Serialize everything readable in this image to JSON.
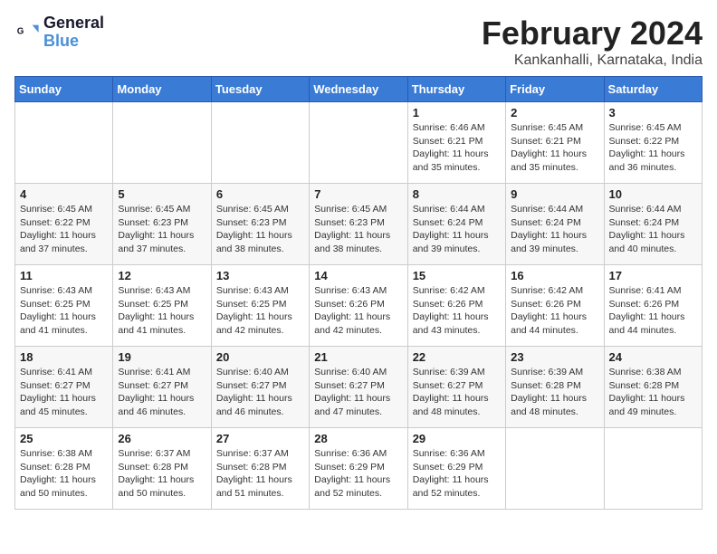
{
  "logo": {
    "line1": "General",
    "line2": "Blue"
  },
  "title": "February 2024",
  "location": "Kankanhalli, Karnataka, India",
  "days_of_week": [
    "Sunday",
    "Monday",
    "Tuesday",
    "Wednesday",
    "Thursday",
    "Friday",
    "Saturday"
  ],
  "weeks": [
    [
      {
        "day": "",
        "info": ""
      },
      {
        "day": "",
        "info": ""
      },
      {
        "day": "",
        "info": ""
      },
      {
        "day": "",
        "info": ""
      },
      {
        "day": "1",
        "info": "Sunrise: 6:46 AM\nSunset: 6:21 PM\nDaylight: 11 hours\nand 35 minutes."
      },
      {
        "day": "2",
        "info": "Sunrise: 6:45 AM\nSunset: 6:21 PM\nDaylight: 11 hours\nand 35 minutes."
      },
      {
        "day": "3",
        "info": "Sunrise: 6:45 AM\nSunset: 6:22 PM\nDaylight: 11 hours\nand 36 minutes."
      }
    ],
    [
      {
        "day": "4",
        "info": "Sunrise: 6:45 AM\nSunset: 6:22 PM\nDaylight: 11 hours\nand 37 minutes."
      },
      {
        "day": "5",
        "info": "Sunrise: 6:45 AM\nSunset: 6:23 PM\nDaylight: 11 hours\nand 37 minutes."
      },
      {
        "day": "6",
        "info": "Sunrise: 6:45 AM\nSunset: 6:23 PM\nDaylight: 11 hours\nand 38 minutes."
      },
      {
        "day": "7",
        "info": "Sunrise: 6:45 AM\nSunset: 6:23 PM\nDaylight: 11 hours\nand 38 minutes."
      },
      {
        "day": "8",
        "info": "Sunrise: 6:44 AM\nSunset: 6:24 PM\nDaylight: 11 hours\nand 39 minutes."
      },
      {
        "day": "9",
        "info": "Sunrise: 6:44 AM\nSunset: 6:24 PM\nDaylight: 11 hours\nand 39 minutes."
      },
      {
        "day": "10",
        "info": "Sunrise: 6:44 AM\nSunset: 6:24 PM\nDaylight: 11 hours\nand 40 minutes."
      }
    ],
    [
      {
        "day": "11",
        "info": "Sunrise: 6:43 AM\nSunset: 6:25 PM\nDaylight: 11 hours\nand 41 minutes."
      },
      {
        "day": "12",
        "info": "Sunrise: 6:43 AM\nSunset: 6:25 PM\nDaylight: 11 hours\nand 41 minutes."
      },
      {
        "day": "13",
        "info": "Sunrise: 6:43 AM\nSunset: 6:25 PM\nDaylight: 11 hours\nand 42 minutes."
      },
      {
        "day": "14",
        "info": "Sunrise: 6:43 AM\nSunset: 6:26 PM\nDaylight: 11 hours\nand 42 minutes."
      },
      {
        "day": "15",
        "info": "Sunrise: 6:42 AM\nSunset: 6:26 PM\nDaylight: 11 hours\nand 43 minutes."
      },
      {
        "day": "16",
        "info": "Sunrise: 6:42 AM\nSunset: 6:26 PM\nDaylight: 11 hours\nand 44 minutes."
      },
      {
        "day": "17",
        "info": "Sunrise: 6:41 AM\nSunset: 6:26 PM\nDaylight: 11 hours\nand 44 minutes."
      }
    ],
    [
      {
        "day": "18",
        "info": "Sunrise: 6:41 AM\nSunset: 6:27 PM\nDaylight: 11 hours\nand 45 minutes."
      },
      {
        "day": "19",
        "info": "Sunrise: 6:41 AM\nSunset: 6:27 PM\nDaylight: 11 hours\nand 46 minutes."
      },
      {
        "day": "20",
        "info": "Sunrise: 6:40 AM\nSunset: 6:27 PM\nDaylight: 11 hours\nand 46 minutes."
      },
      {
        "day": "21",
        "info": "Sunrise: 6:40 AM\nSunset: 6:27 PM\nDaylight: 11 hours\nand 47 minutes."
      },
      {
        "day": "22",
        "info": "Sunrise: 6:39 AM\nSunset: 6:27 PM\nDaylight: 11 hours\nand 48 minutes."
      },
      {
        "day": "23",
        "info": "Sunrise: 6:39 AM\nSunset: 6:28 PM\nDaylight: 11 hours\nand 48 minutes."
      },
      {
        "day": "24",
        "info": "Sunrise: 6:38 AM\nSunset: 6:28 PM\nDaylight: 11 hours\nand 49 minutes."
      }
    ],
    [
      {
        "day": "25",
        "info": "Sunrise: 6:38 AM\nSunset: 6:28 PM\nDaylight: 11 hours\nand 50 minutes."
      },
      {
        "day": "26",
        "info": "Sunrise: 6:37 AM\nSunset: 6:28 PM\nDaylight: 11 hours\nand 50 minutes."
      },
      {
        "day": "27",
        "info": "Sunrise: 6:37 AM\nSunset: 6:28 PM\nDaylight: 11 hours\nand 51 minutes."
      },
      {
        "day": "28",
        "info": "Sunrise: 6:36 AM\nSunset: 6:29 PM\nDaylight: 11 hours\nand 52 minutes."
      },
      {
        "day": "29",
        "info": "Sunrise: 6:36 AM\nSunset: 6:29 PM\nDaylight: 11 hours\nand 52 minutes."
      },
      {
        "day": "",
        "info": ""
      },
      {
        "day": "",
        "info": ""
      }
    ]
  ]
}
